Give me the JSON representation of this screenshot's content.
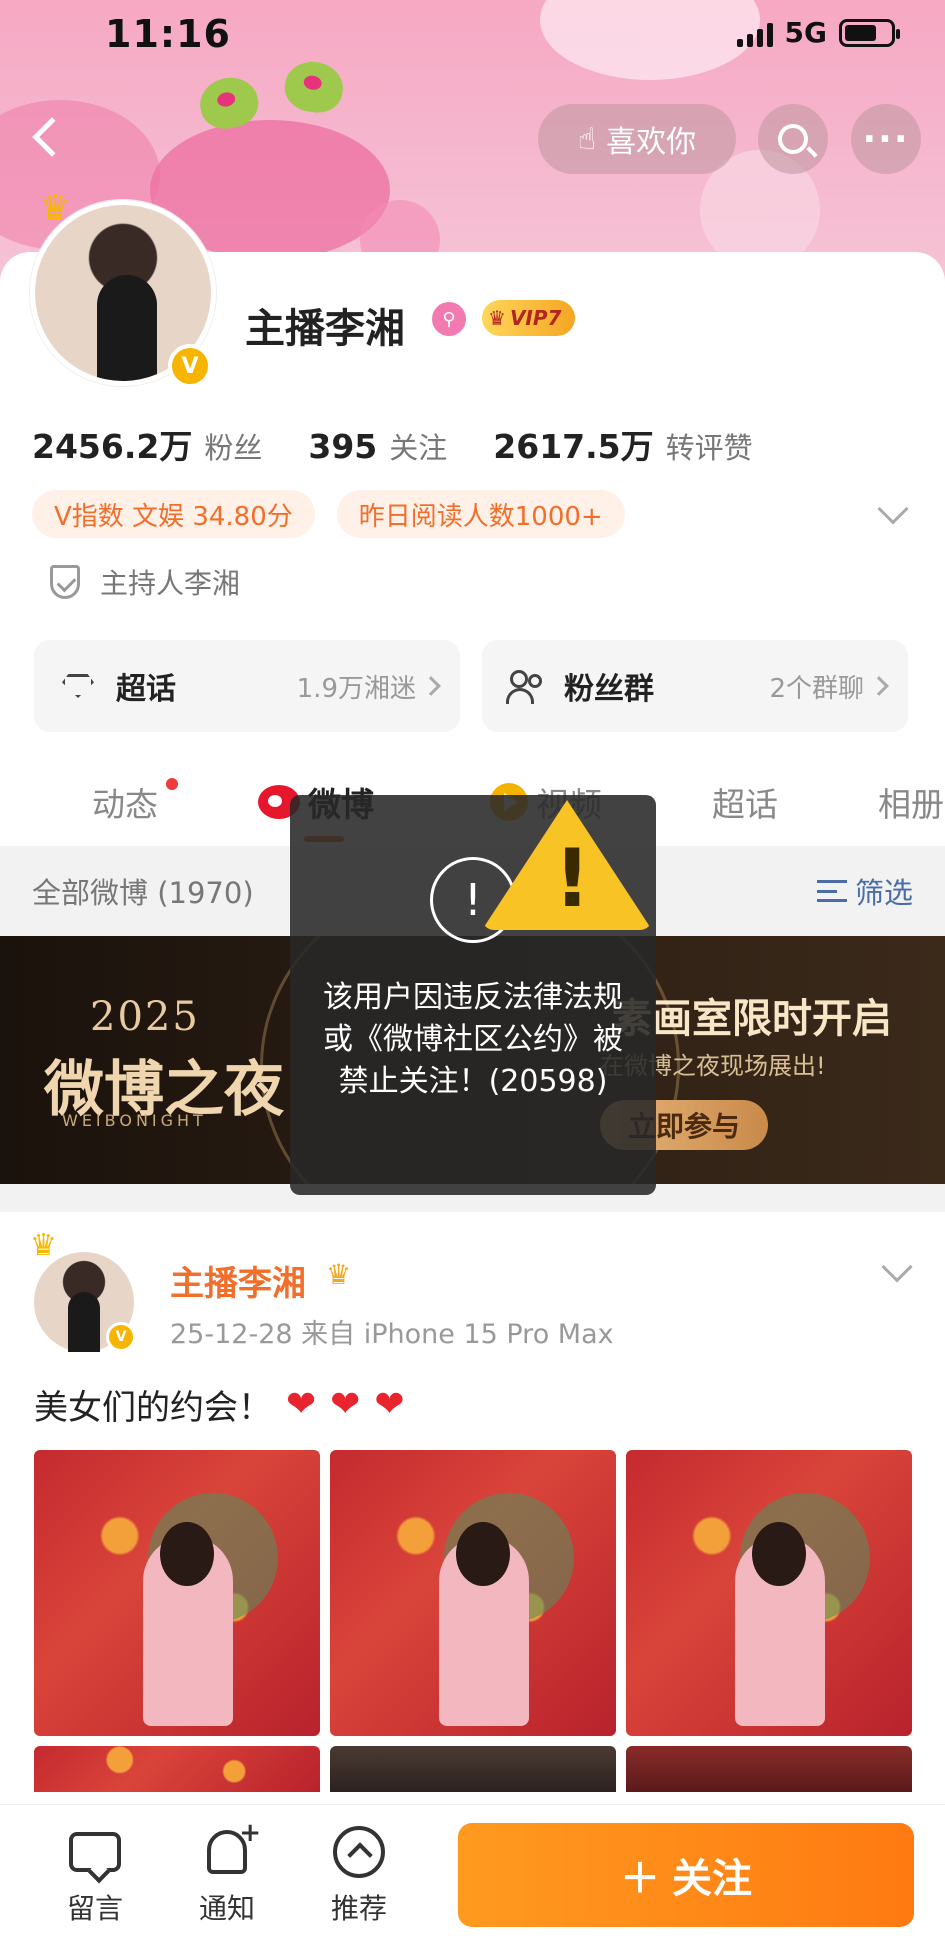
{
  "status_bar": {
    "time": "11:16",
    "network": "5G"
  },
  "header": {
    "like_label": "喜欢你",
    "more_label": "···"
  },
  "profile": {
    "name": "主播李湘",
    "vip_label": "VIP7",
    "stats": [
      {
        "value": "2456.2万",
        "label": "粉丝"
      },
      {
        "value": "395",
        "label": "关注"
      },
      {
        "value": "2617.5万",
        "label": "转评赞"
      }
    ],
    "tags": [
      "V指数 文娱 34.80分",
      "昨日阅读人数1000+"
    ],
    "certification": "主持人李湘",
    "cards": [
      {
        "title": "超话",
        "sub": "1.9万湘迷"
      },
      {
        "title": "粉丝群",
        "sub": "2个群聊"
      }
    ]
  },
  "tabs": [
    "动态",
    "微博",
    "视频",
    "超话",
    "相册"
  ],
  "filter": {
    "all_label": "全部微博 (1970)",
    "filter_label": "筛选"
  },
  "promo": {
    "year": "2025",
    "big": "微博之夜",
    "en": "WEIBONIGHT",
    "title": "素画室限时开启",
    "sub": "在微博之夜现场展出!",
    "cta": "立即参与"
  },
  "post": {
    "author": "主播李湘",
    "meta": "25-12-28  来自 iPhone 15 Pro Max",
    "text": "美女们的约会！"
  },
  "toast": {
    "message": "该用户因违反法律法规或《微博社区公约》被禁止关注！(20598)"
  },
  "bottom_bar": {
    "items": [
      "留言",
      "通知",
      "推荐"
    ],
    "follow_label": "关注"
  },
  "colors": {
    "accent": "#ff8a1a",
    "brand_orange": "#f26f2b",
    "toast_bg": "#282828",
    "warning_yellow": "#f7c325"
  }
}
